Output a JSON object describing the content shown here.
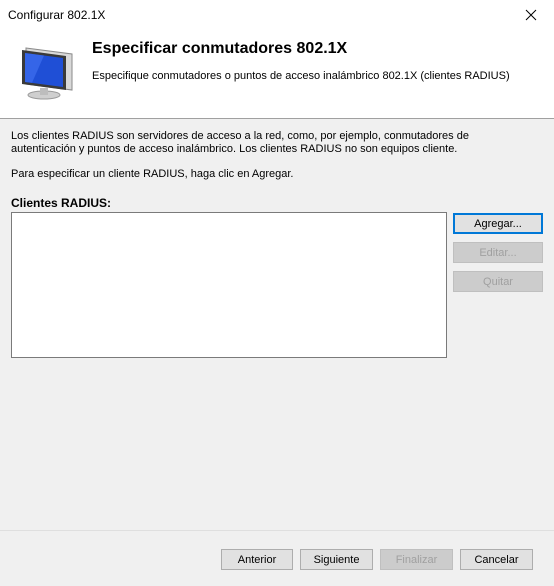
{
  "window": {
    "title": "Configurar 802.1X"
  },
  "header": {
    "title": "Especificar conmutadores 802.1X",
    "subtitle": "Especifique conmutadores o puntos de acceso inalámbrico 802.1X (clientes RADIUS)"
  },
  "body": {
    "description_line1": "Los clientes RADIUS son servidores de acceso a la red, como, por ejemplo, conmutadores de",
    "description_line2": "autenticación y puntos de acceso inalámbrico. Los clientes RADIUS no son equipos cliente.",
    "instruction": "Para especificar un cliente RADIUS, haga clic en Agregar.",
    "list_label": "Clientes RADIUS:",
    "clients": []
  },
  "side_buttons": {
    "add": "Agregar...",
    "edit": "Editar...",
    "remove": "Quitar"
  },
  "footer": {
    "back": "Anterior",
    "next": "Siguiente",
    "finish": "Finalizar",
    "cancel": "Cancelar"
  },
  "icons": {
    "close": "close-icon",
    "header": "monitor-icon"
  }
}
